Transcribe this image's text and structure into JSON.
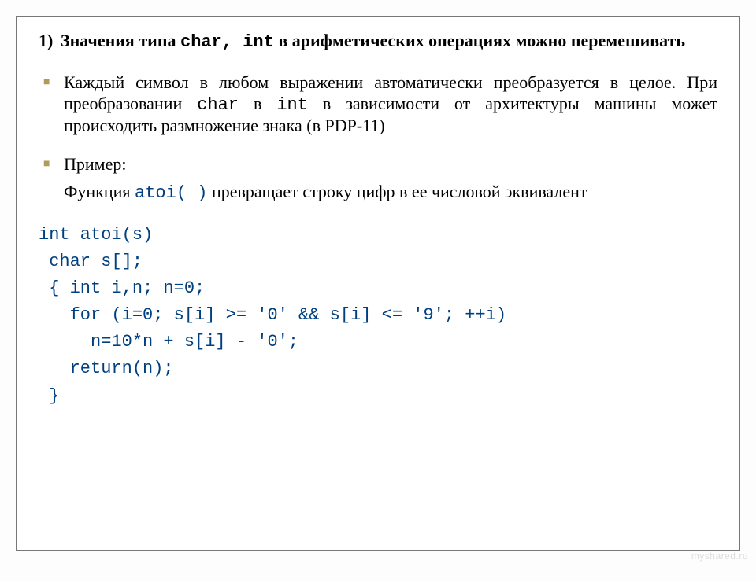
{
  "item1": {
    "marker": "1)",
    "text_before": "Значения типа ",
    "code": "char, int",
    "text_after": " в арифметических операциях можно перемешивать"
  },
  "bullet1": {
    "t1": "Каждый символ в любом выражении автоматически преобразуется в целое. При преобразовании ",
    "c1": "char",
    "t2": " в ",
    "c2": "int",
    "t3": " в зависимости от архитектуры машины может происходить размножение знака (в PDP-11)"
  },
  "bullet2": {
    "label": "Пример:",
    "line_a": " Функция ",
    "line_code": "atoi( )",
    "line_b": " превращает строку цифр в ее числовой эквивалент"
  },
  "code": {
    "l1": "int atoi(s)",
    "l2": " char s[];",
    "l3": " { int i,n; n=0;",
    "l4": "   for (i=0; s[i] >= '0' && s[i] <= '9'; ++i)",
    "l5": "     n=10*n + s[i] - '0';",
    "l6": "   return(n);",
    "l7": " }"
  },
  "watermark": "myshared.ru"
}
